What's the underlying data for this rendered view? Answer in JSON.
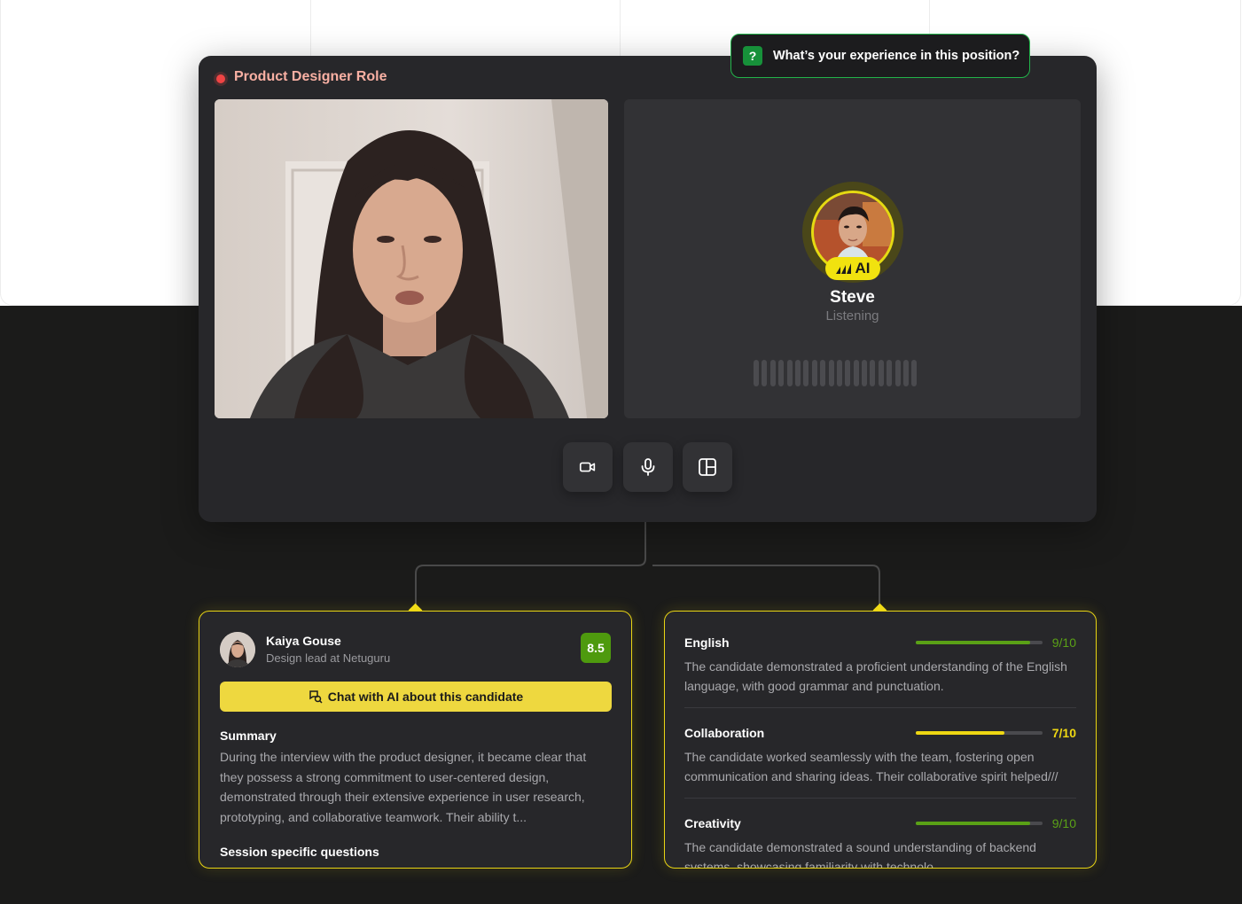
{
  "window": {
    "title": "Product Designer Role"
  },
  "question": {
    "icon": "?",
    "text": "What’s your experience in this position?"
  },
  "ai_interviewer": {
    "name": "Steve",
    "status": "Listening",
    "badge": "AI"
  },
  "controls": [
    {
      "name": "camera-button",
      "icon": "video-camera-icon"
    },
    {
      "name": "microphone-button",
      "icon": "microphone-icon"
    },
    {
      "name": "layout-button",
      "icon": "layout-icon"
    }
  ],
  "candidate": {
    "name": "Kaiya Gouse",
    "role": "Design lead at Netuguru",
    "score": "8.5",
    "chat_label": "Chat with AI about this candidate",
    "summary_title": "Summary",
    "summary": "During the interview with the product designer, it became clear that they possess a strong commitment to user-centered design, demonstrated through their extensive experience in user research, prototyping, and collaborative teamwork. Their ability t...",
    "questions_title": "Session specific questions"
  },
  "skills": [
    {
      "name": "English",
      "score": "9/10",
      "value": 0.9,
      "color": "#5aa116",
      "description": "The candidate demonstrated a proficient understanding of the English language, with good grammar and punctuation."
    },
    {
      "name": "Collaboration",
      "score": "7/10",
      "value": 0.7,
      "color": "#eed712",
      "description": "The candidate worked seamlessly with the team, fostering open communication and sharing ideas. Their collaborative spirit helped///"
    },
    {
      "name": "Creativity",
      "score": "9/10",
      "value": 0.9,
      "color": "#5aa116",
      "description": "The candidate demonstrated a sound understanding of backend systems, showcasing familiarity with technolo..."
    }
  ],
  "colors": {
    "accent_yellow": "#eed83f",
    "accent_green": "#22b34a",
    "recording_red": "#ef4444",
    "score_green": "#4e9a0e"
  }
}
